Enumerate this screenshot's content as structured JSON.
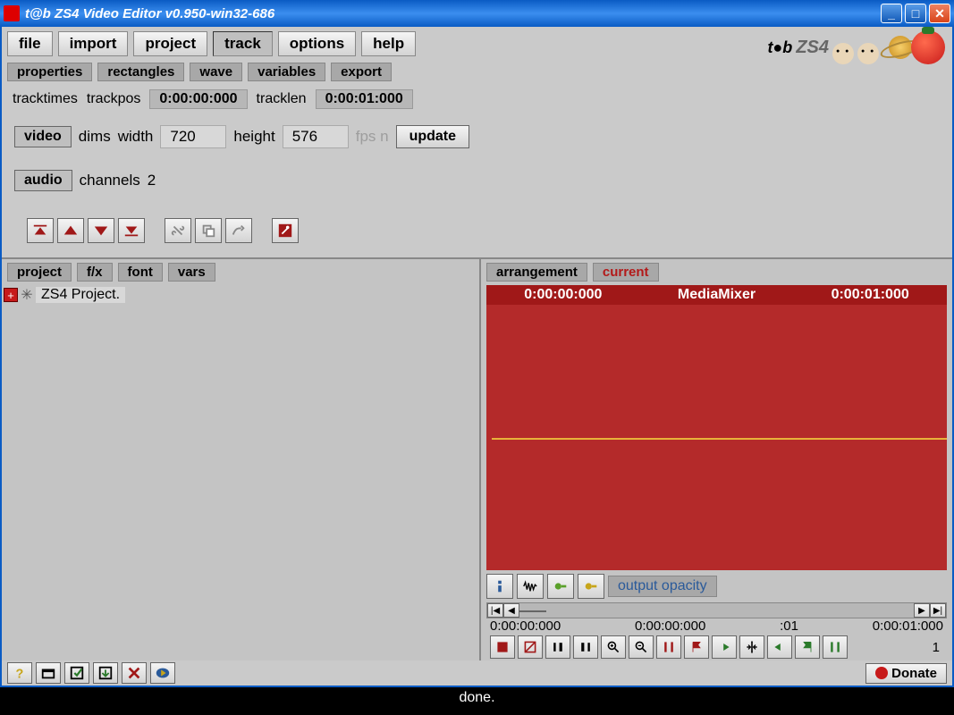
{
  "window": {
    "title": "t@b ZS4 Video Editor v0.950-win32-686"
  },
  "menu": {
    "file": "file",
    "import": "import",
    "project": "project",
    "track": "track",
    "options": "options",
    "help": "help"
  },
  "subtabs": {
    "properties": "properties",
    "rectangles": "rectangles",
    "wave": "wave",
    "variables": "variables",
    "export": "export"
  },
  "trackinfo": {
    "times_lbl": "tracktimes",
    "pos_lbl": "trackpos",
    "pos_val": "0:00:00:000",
    "len_lbl": "tracklen",
    "len_val": "0:00:01:000"
  },
  "video": {
    "btn": "video",
    "dims": "dims",
    "width_lbl": "width",
    "width_val": "720",
    "height_lbl": "height",
    "height_val": "576",
    "fps_lbl": "fps  n",
    "update": "update"
  },
  "audio": {
    "btn": "audio",
    "channels_lbl": "channels",
    "channels_val": "2"
  },
  "lefttabs": {
    "project": "project",
    "fx": "f/x",
    "font": "font",
    "vars": "vars"
  },
  "tree": {
    "root": "ZS4 Project."
  },
  "righttabs": {
    "arrangement": "arrangement",
    "current": "current"
  },
  "media": {
    "start": "0:00:00:000",
    "name": "MediaMixer",
    "end": "0:00:01:000",
    "output_opacity": "output opacity"
  },
  "timeline": {
    "t0": "0:00:00:000",
    "t1": "0:00:00:000",
    "t2": ":01",
    "t3": "0:00:01:000",
    "count": "1"
  },
  "donate": "Donate",
  "status": "done.",
  "logo": {
    "tab": "t●b",
    "zs4": "ZS4"
  }
}
